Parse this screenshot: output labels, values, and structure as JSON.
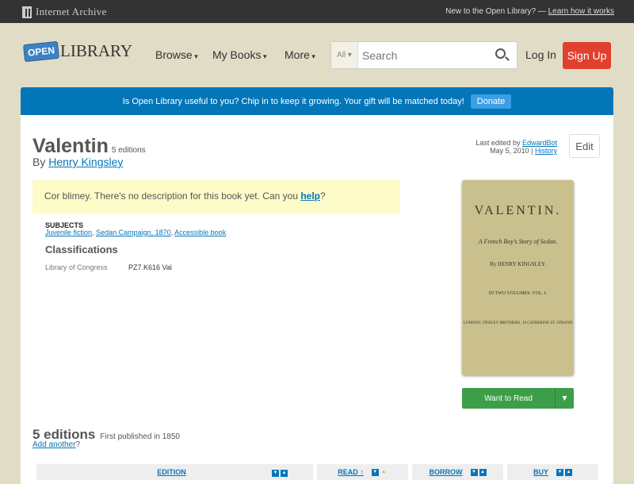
{
  "topbar": {
    "brand": "Internet Archive",
    "new_text": "New to the Open Library? —",
    "learn_link": "Learn how it works"
  },
  "header": {
    "logo_open": "OPEN",
    "logo_library": "LIBRARY",
    "nav": [
      "Browse",
      "My Books",
      "More"
    ],
    "search_scope": "All ▾",
    "search_placeholder": "Search",
    "login": "Log In",
    "signup": "Sign Up"
  },
  "banner": {
    "text": "Is Open Library useful to you? Chip in to keep it growing. Your gift will be matched today!",
    "donate": "Donate"
  },
  "book": {
    "title": "Valentin",
    "edition_count": "5 editions",
    "by": "By",
    "author": "Henry Kingsley",
    "last_edited_prefix": "Last edited by",
    "last_edited_by": "EdwardBot",
    "date": "May 5, 2010 |",
    "history": "History",
    "edit": "Edit",
    "desc_text": "Cor blimey. There's no description for this book yet. Can you",
    "desc_help": "help",
    "desc_q": "?",
    "subjects_label": "SUBJECTS",
    "subjects": [
      "Juvenile fiction",
      "Sedan Campaign, 1870",
      "Accessible book"
    ],
    "classifications_label": "Classifications",
    "loc_label": "Library of Congress",
    "loc_value": "PZ7.K616 Val",
    "cover": {
      "title": "VALENTIN.",
      "subtitle": "A French Boy's Story of Sedan.",
      "author": "By HENRY KINGSLEY.",
      "volume": "IN TWO VOLUMES. VOL. I.",
      "publisher": "LONDON: TINSLEY BROTHERS, 18 CATHERINE ST. STRAND"
    },
    "want_to_read": "Want to Read"
  },
  "editions": {
    "heading": "5 editions",
    "first_published": "First published in 1850",
    "add_another": "Add another",
    "add_q": "?",
    "columns": [
      "EDITION",
      "READ ↑",
      "BORROW",
      "BUY"
    ]
  },
  "colors": {
    "accent": "#0376b8",
    "signup": "#e0402d",
    "want": "#3d9e4a",
    "bg": "#e1dcc5"
  }
}
